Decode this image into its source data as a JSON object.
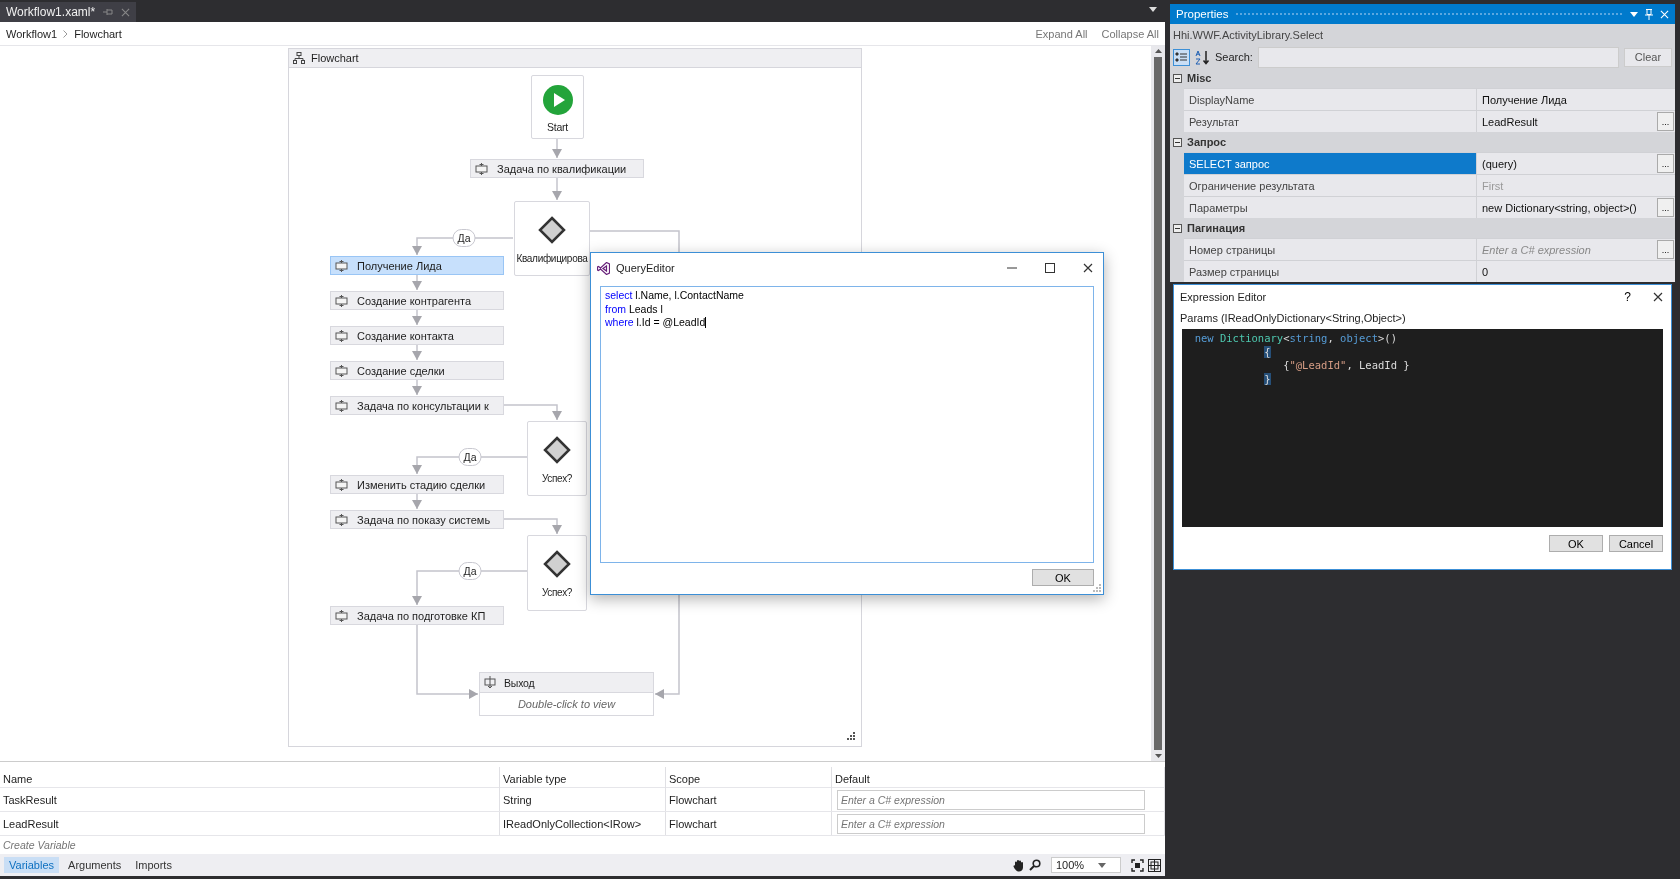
{
  "document_tab": {
    "title": "Workflow1.xaml*",
    "selected": true
  },
  "breadcrumb": [
    "Workflow1",
    "Flowchart"
  ],
  "designer_actions": [
    "Expand All",
    "Collapse All"
  ],
  "flowchart": {
    "title": "Flowchart",
    "nodes": [
      {
        "kind": "start",
        "label": "Start"
      },
      {
        "kind": "activity",
        "label": "Задача по квалификации",
        "selected": false
      },
      {
        "kind": "decision",
        "label": "Квалифицирова"
      },
      {
        "kind": "activity",
        "label": "Получение Лида",
        "selected": true
      },
      {
        "kind": "activity",
        "label": "Создание контрагента",
        "selected": false
      },
      {
        "kind": "activity",
        "label": "Создание контакта",
        "selected": false
      },
      {
        "kind": "activity",
        "label": "Создание сделки",
        "selected": false
      },
      {
        "kind": "activity",
        "label": "Задача по консультации к",
        "selected": false
      },
      {
        "kind": "decision",
        "label": "Успех?"
      },
      {
        "kind": "activity",
        "label": "Изменить стадию сделки",
        "selected": false
      },
      {
        "kind": "activity",
        "label": "Задача по показу системь",
        "selected": false
      },
      {
        "kind": "decision",
        "label": "Успех?"
      },
      {
        "kind": "activity",
        "label": "Задача по подготовке КП",
        "selected": false
      },
      {
        "kind": "final",
        "label": "Выход",
        "hint": "Double-click to view"
      }
    ],
    "branch_labels": [
      "Да",
      "Да",
      "Да"
    ]
  },
  "query_editor": {
    "title": "QueryEditor",
    "lines": [
      [
        {
          "text": "select",
          "kind": "keyword"
        },
        {
          "text": " l.Name, l.ContactName",
          "kind": "plain"
        }
      ],
      [
        {
          "text": "from",
          "kind": "keyword"
        },
        {
          "text": " Leads l",
          "kind": "plain"
        }
      ],
      [
        {
          "text": "where",
          "kind": "keyword"
        },
        {
          "text": " l.Id = @LeadId",
          "kind": "plain"
        }
      ]
    ],
    "ok": "OK"
  },
  "variables": {
    "columns": [
      "Name",
      "Variable type",
      "Scope",
      "Default"
    ],
    "rows": [
      {
        "name": "TaskResult",
        "variable_type": "String",
        "scope": "Flowchart",
        "default": {
          "placeholder": "Enter a C# expression"
        }
      },
      {
        "name": "LeadResult",
        "variable_type": "IReadOnlyCollection<IRow>",
        "scope": "Flowchart",
        "default": {
          "placeholder": "Enter a C# expression"
        }
      }
    ],
    "create": {
      "placeholder": "Create Variable"
    }
  },
  "bottom_tabs": [
    {
      "label": "Variables",
      "selected": true
    },
    {
      "label": "Arguments",
      "selected": false
    },
    {
      "label": "Imports",
      "selected": false
    }
  ],
  "zoom": "100%",
  "properties": {
    "title": "Properties",
    "type_name": "Hhi.WWF.ActivityLibrary.Select",
    "search_label": "Search:",
    "clear": "Clear",
    "categories": [
      {
        "name": "Misc",
        "expanded": true,
        "rows": [
          {
            "name": "DisplayName",
            "value": "Получение Лида",
            "selected": false,
            "is_default": false
          },
          {
            "name": "Результат",
            "value": "LeadResult",
            "selected": false,
            "is_default": false,
            "button": "..."
          }
        ]
      },
      {
        "name": "Запрос",
        "expanded": true,
        "rows": [
          {
            "name": "SELECT запрос",
            "value": "(query)",
            "selected": true,
            "is_default": false,
            "button": "..."
          },
          {
            "name": "Ограничение результата",
            "value": "First",
            "selected": false,
            "is_default": true
          },
          {
            "name": "Параметры",
            "value": "new Dictionary<string, object>()",
            "selected": false,
            "is_default": false,
            "button": "..."
          }
        ]
      },
      {
        "name": "Пагинация",
        "expanded": true,
        "rows": [
          {
            "name": "Номер страницы",
            "placeholder": "Enter a C# expression",
            "selected": false,
            "button": "..."
          },
          {
            "name": "Размер страницы",
            "value": "0",
            "selected": false,
            "is_default": false
          }
        ]
      }
    ]
  },
  "expression_editor": {
    "title": "Expression Editor",
    "help": "?",
    "label": "Params (IReadOnlyDictionary<String,Object>)",
    "lines": [
      [
        {
          "text": "new ",
          "kind": "keyword"
        },
        {
          "text": "Dictionary",
          "kind": "type"
        },
        {
          "text": "<",
          "kind": "plain"
        },
        {
          "text": "string",
          "kind": "keyword"
        },
        {
          "text": ", ",
          "kind": "plain"
        },
        {
          "text": "object",
          "kind": "keyword"
        },
        {
          "text": ">()",
          "kind": "plain"
        }
      ],
      [
        {
          "text": "{",
          "kind": "brace_match"
        }
      ],
      [
        {
          "text": "{",
          "kind": "plain"
        },
        {
          "text": "\"@LeadId\"",
          "kind": "string"
        },
        {
          "text": ", LeadId }",
          "kind": "plain"
        }
      ],
      [
        {
          "text": "}",
          "kind": "brace_match"
        }
      ]
    ],
    "buttons": [
      "OK",
      "Cancel"
    ]
  }
}
